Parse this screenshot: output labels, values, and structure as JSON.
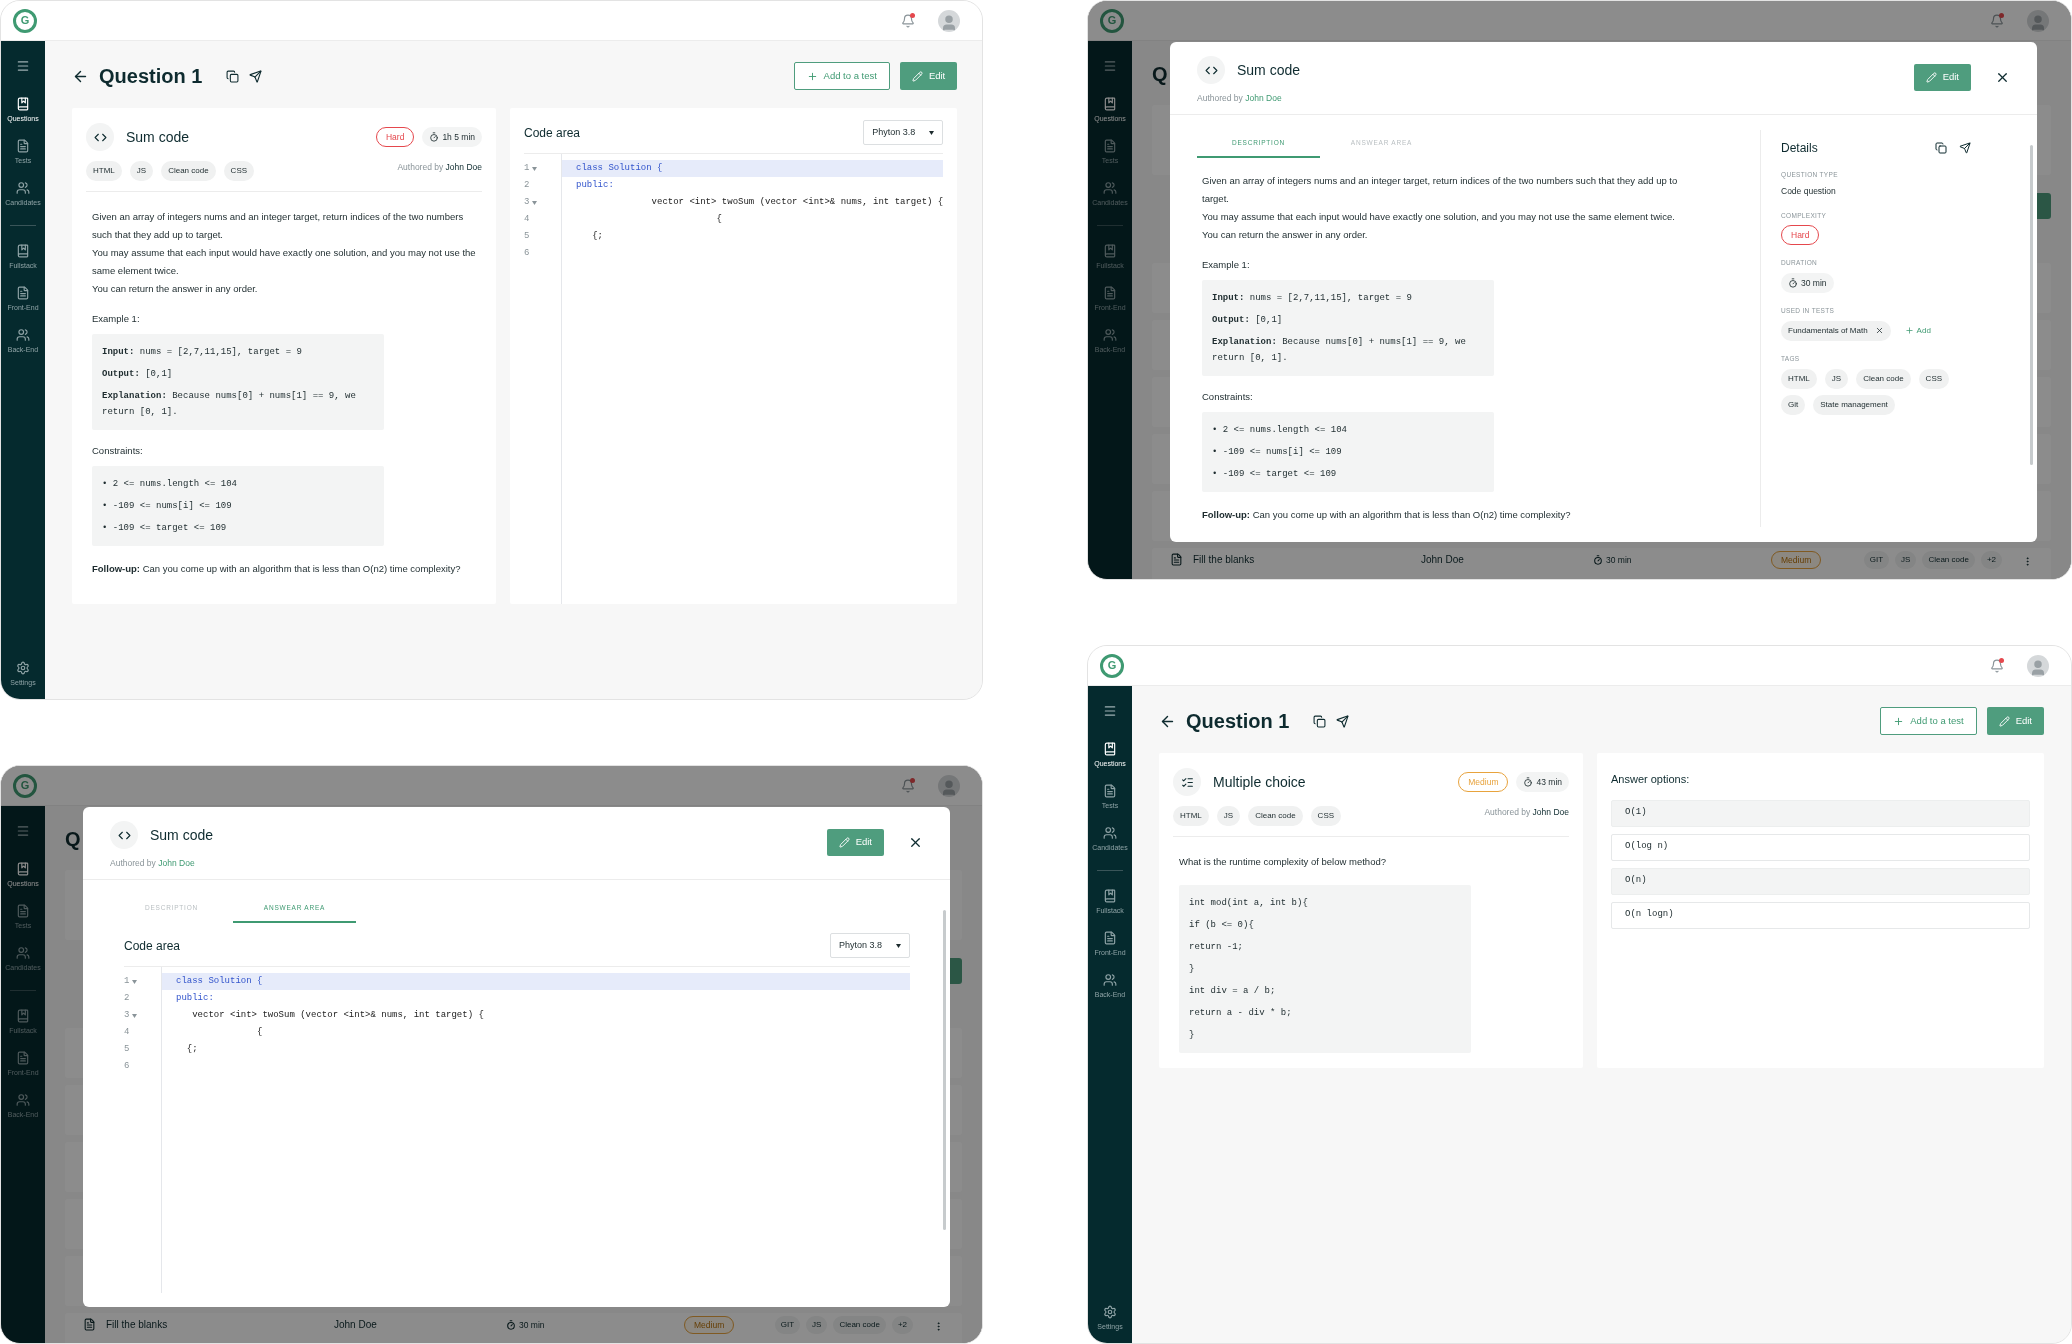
{
  "screens": [
    {
      "dimmed": false,
      "topbar": {
        "logo": "G",
        "notification": true
      },
      "sidebar": {
        "items": [
          {
            "label": "Questions",
            "kind": "questions",
            "selected": true
          },
          {
            "label": "Tests",
            "kind": "tests",
            "selected": false
          },
          {
            "label": "Candidates",
            "kind": "people",
            "selected": false
          }
        ],
        "categories": [
          {
            "label": "Fullstack",
            "kind": "questions",
            "selected": false
          },
          {
            "label": "Front-End",
            "kind": "tests",
            "selected": false
          },
          {
            "label": "Back-End",
            "kind": "people",
            "selected": false
          }
        ],
        "settings": "Settings"
      },
      "page": {
        "title": "Question 1",
        "add_button": "Add to a test",
        "edit_button": "Edit",
        "question": {
          "kind": "code",
          "title": "Sum code",
          "difficulty": {
            "label": "Hard",
            "color": "#e5484d"
          },
          "duration": "1h 5 min",
          "tags": [
            "HTML",
            "JS",
            "Clean code",
            "CSS"
          ],
          "author_prefix": "Authored by",
          "author": "John Doe",
          "body": [
            {
              "kind": "text",
              "text": "Given an array of integers nums and an integer target, return indices of the two numbers such that they add up to target."
            },
            {
              "kind": "text",
              "text": "You may assume that each input would have exactly one solution, and you may not use the same element twice."
            },
            {
              "kind": "text",
              "text": "You can return the answer in any order."
            },
            {
              "kind": "heading",
              "text": "Example 1:"
            },
            {
              "kind": "code",
              "lines": [
                "**Input:** nums = [2,7,11,15], target = 9",
                "**Output:** [0,1]",
                "**Explanation:** Because nums[0] + nums[1] == 9, we return [0, 1]."
              ]
            },
            {
              "kind": "heading",
              "text": "Constraints:"
            },
            {
              "kind": "code",
              "lines": [
                "• 2 <= nums.length <= 104",
                "• -109 <= nums[i] <= 109",
                "• -109 <= target <= 109"
              ]
            },
            {
              "kind": "text",
              "text": "**Follow-up:** Can you come up with an algorithm that is less than O(n2) time complexity?"
            }
          ]
        },
        "panel": {
          "kind": "code",
          "title": "Code area",
          "language": "Phyton 3.8",
          "lines": [
            {
              "number": "1",
              "text": "class Solution {",
              "kind": "keyword",
              "highlighted": true,
              "foldable": true
            },
            {
              "number": "2",
              "text": "public:",
              "kind": "keyword",
              "highlighted": false,
              "foldable": false
            },
            {
              "number": "3",
              "text": "              vector <int> twoSum (vector <int>& nums, int target) {",
              "kind": "plain",
              "highlighted": false,
              "foldable": true
            },
            {
              "number": "4",
              "text": "                          {",
              "kind": "plain",
              "highlighted": false,
              "foldable": false
            },
            {
              "number": "5",
              "text": "   {;",
              "kind": "plain",
              "highlighted": false,
              "foldable": false
            },
            {
              "number": "6",
              "kind": "plain",
              "highlighted": false,
              "foldable": false
            }
          ]
        }
      }
    },
    {
      "dimmed": true,
      "topbar": {
        "logo": "G",
        "notification": true
      },
      "sidebar": {
        "items": [
          {
            "label": "Questions",
            "kind": "questions",
            "selected": true
          },
          {
            "label": "Tests",
            "kind": "tests",
            "selected": false
          },
          {
            "label": "Candidates",
            "kind": "people",
            "selected": false
          }
        ],
        "categories": [
          {
            "label": "Fullstack",
            "kind": "questions",
            "selected": false
          },
          {
            "label": "Front-End",
            "kind": "tests",
            "selected": false
          },
          {
            "label": "Back-End",
            "kind": "people",
            "selected": false
          }
        ]
      },
      "backdrop": {
        "heading": "Q",
        "row": {
          "title": "Fill the blanks",
          "author": "John Doe",
          "duration": "30 min",
          "difficulty": "Medium",
          "tags": [
            "GIT",
            "JS",
            "Clean code"
          ],
          "more": "+2"
        }
      },
      "modal": {
        "kind": "code",
        "title": "Sum code",
        "author_prefix": "Authored by",
        "author": "John Doe",
        "edit_button": "Edit",
        "tabs": [
          {
            "label": "DESCRIPTION",
            "selected": false
          },
          {
            "label": "ANSWEAR AREA",
            "selected": true
          }
        ],
        "content": {
          "kind": "code",
          "title": "Code area",
          "language": "Phyton 3.8",
          "lines": [
            {
              "number": "1",
              "text": "class Solution {",
              "kind": "keyword",
              "highlighted": true,
              "foldable": true
            },
            {
              "number": "2",
              "text": "public:",
              "kind": "keyword",
              "highlighted": false,
              "foldable": false
            },
            {
              "number": "3",
              "text": "   vector <int> twoSum (vector <int>& nums, int target) {",
              "kind": "plain",
              "highlighted": false,
              "foldable": true
            },
            {
              "number": "4",
              "text": "               {",
              "kind": "plain",
              "highlighted": false,
              "foldable": false
            },
            {
              "number": "5",
              "text": "  {;",
              "kind": "plain",
              "highlighted": false,
              "foldable": false
            },
            {
              "number": "6",
              "kind": "plain",
              "highlighted": false,
              "foldable": false
            }
          ]
        }
      }
    },
    {
      "dimmed": true,
      "topbar": {
        "logo": "G",
        "notification": true
      },
      "sidebar": {
        "items": [
          {
            "label": "Questions",
            "kind": "questions",
            "selected": true
          },
          {
            "label": "Tests",
            "kind": "tests",
            "selected": false
          },
          {
            "label": "Candidates",
            "kind": "people",
            "selected": false
          }
        ],
        "categories": [
          {
            "label": "Fullstack",
            "kind": "questions",
            "selected": false
          },
          {
            "label": "Front-End",
            "kind": "tests",
            "selected": false
          },
          {
            "label": "Back-End",
            "kind": "people",
            "selected": false
          }
        ]
      },
      "backdrop": {
        "heading": "Q",
        "row": {
          "title": "Fill the blanks",
          "author": "John Doe",
          "duration": "30 min",
          "difficulty": "Medium",
          "tags": [
            "GIT",
            "JS",
            "Clean code"
          ],
          "more": "+2"
        }
      },
      "modal": {
        "kind": "code",
        "title": "Sum code",
        "author_prefix": "Authored by",
        "author": "John Doe",
        "edit_button": "Edit",
        "tabs": [
          {
            "label": "DESCRIPTION",
            "selected": true
          },
          {
            "label": "ANSWEAR AREA",
            "selected": false
          }
        ],
        "content": {
          "kind": "description",
          "body": [
            {
              "kind": "text",
              "text": "Given an array of integers nums and an integer target, return indices of the two numbers such that they add up to target."
            },
            {
              "kind": "text",
              "text": "You may assume that each input would have exactly one solution, and you may not use the same element twice."
            },
            {
              "kind": "text",
              "text": "You can return the answer in any order."
            },
            {
              "kind": "heading",
              "text": "Example 1:"
            },
            {
              "kind": "code",
              "lines": [
                "**Input:** nums = [2,7,11,15], target = 9",
                "**Output:** [0,1]",
                "**Explanation:** Because nums[0] + nums[1] == 9, we return [0, 1]."
              ]
            },
            {
              "kind": "heading",
              "text": "Constraints:"
            },
            {
              "kind": "code",
              "lines": [
                "• 2 <= nums.length <= 104",
                "• -109 <= nums[i] <= 109",
                "• -109 <= target <= 109"
              ]
            },
            {
              "kind": "text",
              "text": "**Follow-up:** Can you come up with an algorithm that is less than O(n2) time complexity?"
            }
          ]
        },
        "details": {
          "title": "Details",
          "fields": [
            {
              "label": "QUESTION TYPE",
              "kind": "text",
              "value": "Code question"
            },
            {
              "label": "COMPLEXITY",
              "kind": "badge",
              "value": "Hard",
              "color": "#e5484d"
            },
            {
              "label": "DURATION",
              "kind": "duration",
              "value": "30 min"
            },
            {
              "label": "USED IN TESTS",
              "kind": "tests",
              "chips": [
                "Fundamentals of Math"
              ],
              "add": "Add"
            },
            {
              "label": "TAGS",
              "kind": "tags",
              "chips": [
                "HTML",
                "JS",
                "Clean code",
                "CSS",
                "Git",
                "State management"
              ]
            }
          ]
        }
      }
    },
    {
      "dimmed": false,
      "topbar": {
        "logo": "G",
        "notification": true
      },
      "sidebar": {
        "items": [
          {
            "label": "Questions",
            "kind": "questions",
            "selected": true
          },
          {
            "label": "Tests",
            "kind": "tests",
            "selected": false
          },
          {
            "label": "Candidates",
            "kind": "people",
            "selected": false
          }
        ],
        "categories": [
          {
            "label": "Fullstack",
            "kind": "questions",
            "selected": false
          },
          {
            "label": "Front-End",
            "kind": "tests",
            "selected": false
          },
          {
            "label": "Back-End",
            "kind": "people",
            "selected": false
          }
        ],
        "settings": "Settings"
      },
      "page": {
        "title": "Question 1",
        "add_button": "Add to a test",
        "edit_button": "Edit",
        "question": {
          "kind": "checklist",
          "title": "Multiple choice",
          "difficulty": {
            "label": "Medium",
            "color": "#e8a33d"
          },
          "duration": "43 min",
          "tags": [
            "HTML",
            "JS",
            "Clean code",
            "CSS"
          ],
          "author_prefix": "Authored by",
          "author": "John Doe",
          "body": [
            {
              "kind": "text",
              "text": "What is the runtime complexity of below method?"
            },
            {
              "kind": "code",
              "lines": [
                "int mod(int a, int b){",
                "if (b <= 0){",
                "return -1;",
                "}",
                "int div = a / b;",
                "return a - div * b;",
                "}"
              ]
            }
          ]
        },
        "panel": {
          "kind": "options",
          "title": "Answer options:",
          "options": [
            {
              "text": "O(1)",
              "selected": true
            },
            {
              "text": "O(log n)",
              "selected": false
            },
            {
              "text": "O(n)",
              "selected": true
            },
            {
              "text": "O(n logn)",
              "selected": false
            }
          ]
        }
      }
    }
  ]
}
